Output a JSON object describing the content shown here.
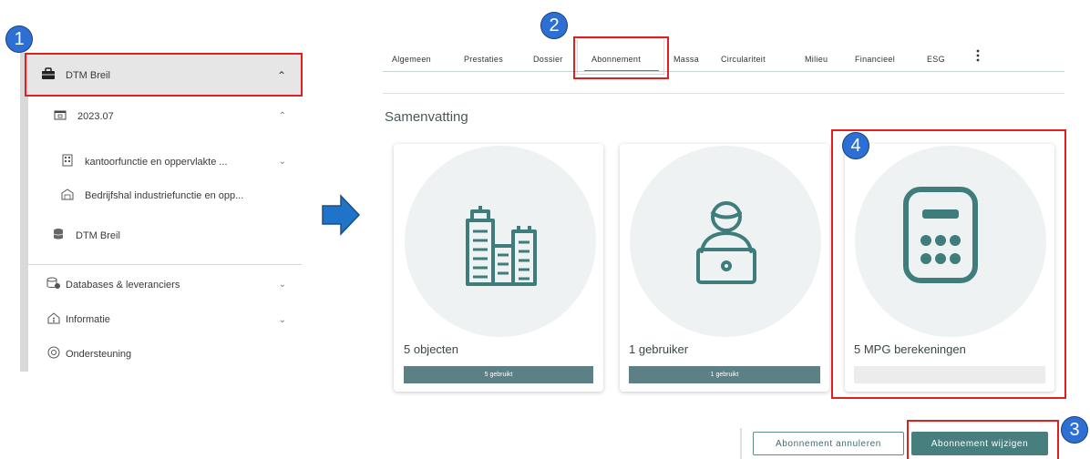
{
  "callouts": [
    "1",
    "2",
    "3",
    "4"
  ],
  "sidebar": {
    "project": {
      "label": "DTM Breil",
      "icon": "briefcase-icon"
    },
    "version": {
      "label": "2023.07",
      "icon": "calendar-icon"
    },
    "objects": [
      {
        "label": "kantoorfunctie en oppervlakte ...",
        "icon": "office-building-icon"
      },
      {
        "label": "Bedrijfshal industriefunctie en opp...",
        "icon": "warehouse-icon"
      }
    ],
    "database_item": {
      "label": "DTM Breil",
      "icon": "database-icon"
    },
    "menu": [
      {
        "label": "Databases & leveranciers",
        "icon": "database-supplier-icon"
      },
      {
        "label": "Informatie",
        "icon": "info-house-icon"
      },
      {
        "label": "Ondersteuning",
        "icon": "support-icon"
      }
    ]
  },
  "tabs": [
    "Algemeen",
    "Prestaties",
    "Dossier",
    "Abonnement",
    "Massa",
    "Circulariteit",
    "Milieu",
    "Financieel",
    "ESG"
  ],
  "active_tab": "Abonnement",
  "section_title": "Samenvatting",
  "cards": [
    {
      "label": "5 objecten",
      "bar_text": "5 gebruikt",
      "icon": "buildings-icon"
    },
    {
      "label": "1 gebruiker",
      "bar_text": "1 gebruikt",
      "icon": "user-laptop-icon"
    },
    {
      "label": "5 MPG berekeningen",
      "bar_text": "",
      "icon": "calculator-icon"
    }
  ],
  "buttons": {
    "cancel": "Abonnement annuleren",
    "change": "Abonnement wijzigen"
  },
  "colors": {
    "accent": "#477e7e",
    "icon_teal": "#3f7d7d",
    "highlight_red": "#e02020",
    "callout_blue": "#2e6fd4"
  }
}
